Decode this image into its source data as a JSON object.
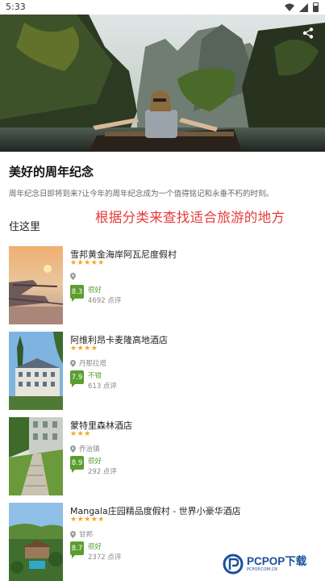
{
  "status_bar": {
    "time": "5:33"
  },
  "hero": {
    "share_icon": "share-icon"
  },
  "promo": {
    "title": "美好的周年纪念",
    "description": "周年纪念日即将到来?让今年的周年纪念成为一个值得铭记和永垂不朽的时刻。"
  },
  "section": {
    "title": "住这里"
  },
  "overlay_caption": "根据分类来查找适合旅游的地方",
  "hotels": [
    {
      "name": "雪邦黄金海岸阿瓦尼度假村",
      "stars": "★★★★★",
      "location": "",
      "score": "8.3",
      "score_label": "很好",
      "reviews": "4692 点评"
    },
    {
      "name": "阿维利昂卡麦隆高地酒店",
      "stars": "★★★★",
      "location": "丹那拉塔",
      "score": "7.9",
      "score_label": "不错",
      "reviews": "613 点评"
    },
    {
      "name": "蒙特里森林酒店",
      "stars": "★★★",
      "location": "乔治镇",
      "score": "8.9",
      "score_label": "很好",
      "reviews": "292 点评"
    },
    {
      "name": "Mangala庄园精品度假村 - 世界小豪华酒店",
      "stars": "★★★★★",
      "location": "甘邦",
      "score": "8.7",
      "score_label": "很好",
      "reviews": "2372 点评"
    }
  ],
  "watermark": {
    "main": "PCPOP下载",
    "sub": "PCPOP.COM.CN"
  },
  "colors": {
    "accent_green": "#5a9e2e",
    "star": "#f4a51c",
    "caption_red": "#e53a3a",
    "watermark_blue": "#1a4f9c"
  }
}
